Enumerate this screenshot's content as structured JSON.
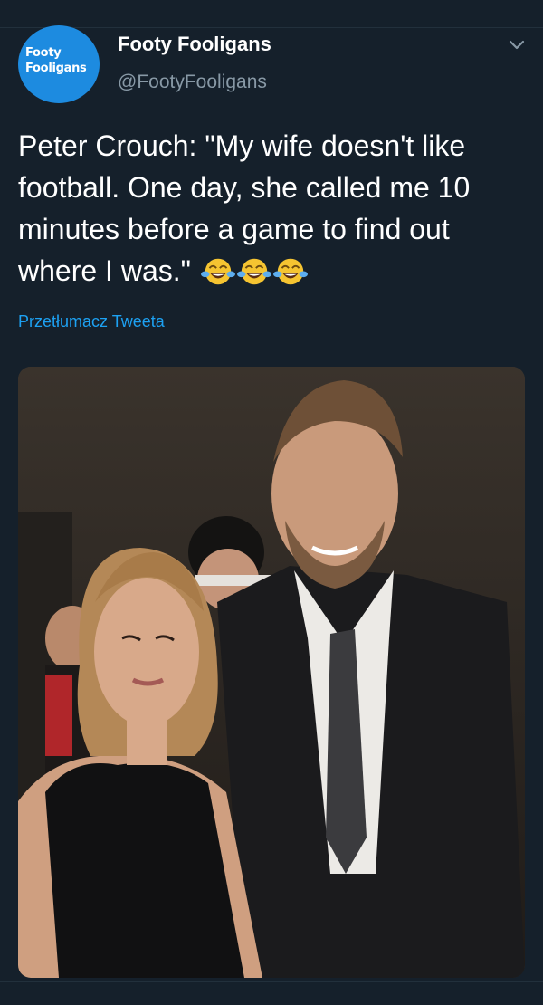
{
  "tweet": {
    "avatar_text_line1": "Footy",
    "avatar_text_line2": "Fooligans",
    "display_name": "Footy Fooligans",
    "handle": "@FootyFooligans",
    "text": "Peter Crouch: \"My wife doesn't like football. One day, she called me 10 minutes before a game to find out where I was.\"",
    "emojis": [
      "face-with-tears-of-joy-icon",
      "face-with-tears-of-joy-icon",
      "face-with-tears-of-joy-icon"
    ],
    "translate_label": "Przetłumacz Tweeta",
    "menu_icon": "chevron-down-icon"
  },
  "colors": {
    "background": "#15202b",
    "accent": "#1da1f2",
    "secondary_text": "#8899a6",
    "avatar_bg": "#1d8be0"
  }
}
